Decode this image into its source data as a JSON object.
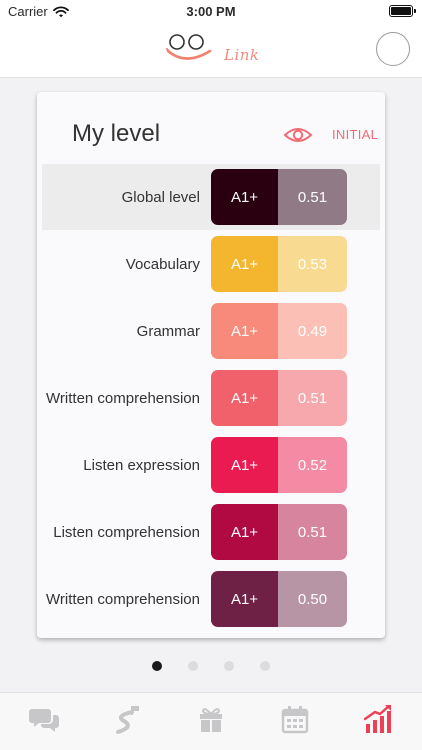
{
  "status_bar": {
    "carrier": "Carrier",
    "time": "3:00 PM"
  },
  "header": {
    "logo_text": "Link"
  },
  "card": {
    "title": "My level",
    "view_mode": "INITIAL",
    "rows": [
      {
        "label": "Global level",
        "level": "A1+",
        "score": "0.51",
        "color_dark": "#2a0010",
        "color_light": "#907a86"
      },
      {
        "label": "Vocabulary",
        "level": "A1+",
        "score": "0.53",
        "color_dark": "#f4b62e",
        "color_light": "#f8da91"
      },
      {
        "label": "Grammar",
        "level": "A1+",
        "score": "0.49",
        "color_dark": "#f78a7b",
        "color_light": "#fbbfb5"
      },
      {
        "label": "Written comprehension",
        "level": "A1+",
        "score": "0.51",
        "color_dark": "#f0616b",
        "color_light": "#f7a8ad"
      },
      {
        "label": "Listen expression",
        "level": "A1+",
        "score": "0.52",
        "color_dark": "#ea1b51",
        "color_light": "#f48aa4"
      },
      {
        "label": "Listen comprehension",
        "level": "A1+",
        "score": "0.51",
        "color_dark": "#b10a43",
        "color_light": "#d7849e"
      },
      {
        "label": "Written comprehension",
        "level": "A1+",
        "score": "0.50",
        "color_dark": "#6f2145",
        "color_light": "#b895a5"
      }
    ]
  },
  "pager": {
    "pages": 4,
    "current": 1
  },
  "tabbar": {
    "tabs": [
      {
        "icon": "chat-bubbles-icon",
        "active": false
      },
      {
        "icon": "road-path-icon",
        "active": false
      },
      {
        "icon": "gift-icon",
        "active": false
      },
      {
        "icon": "calendar-icon",
        "active": false
      },
      {
        "icon": "stats-chart-icon",
        "active": true
      }
    ],
    "inactive_color": "#c7c7c9",
    "active_color": "#ee4055"
  }
}
